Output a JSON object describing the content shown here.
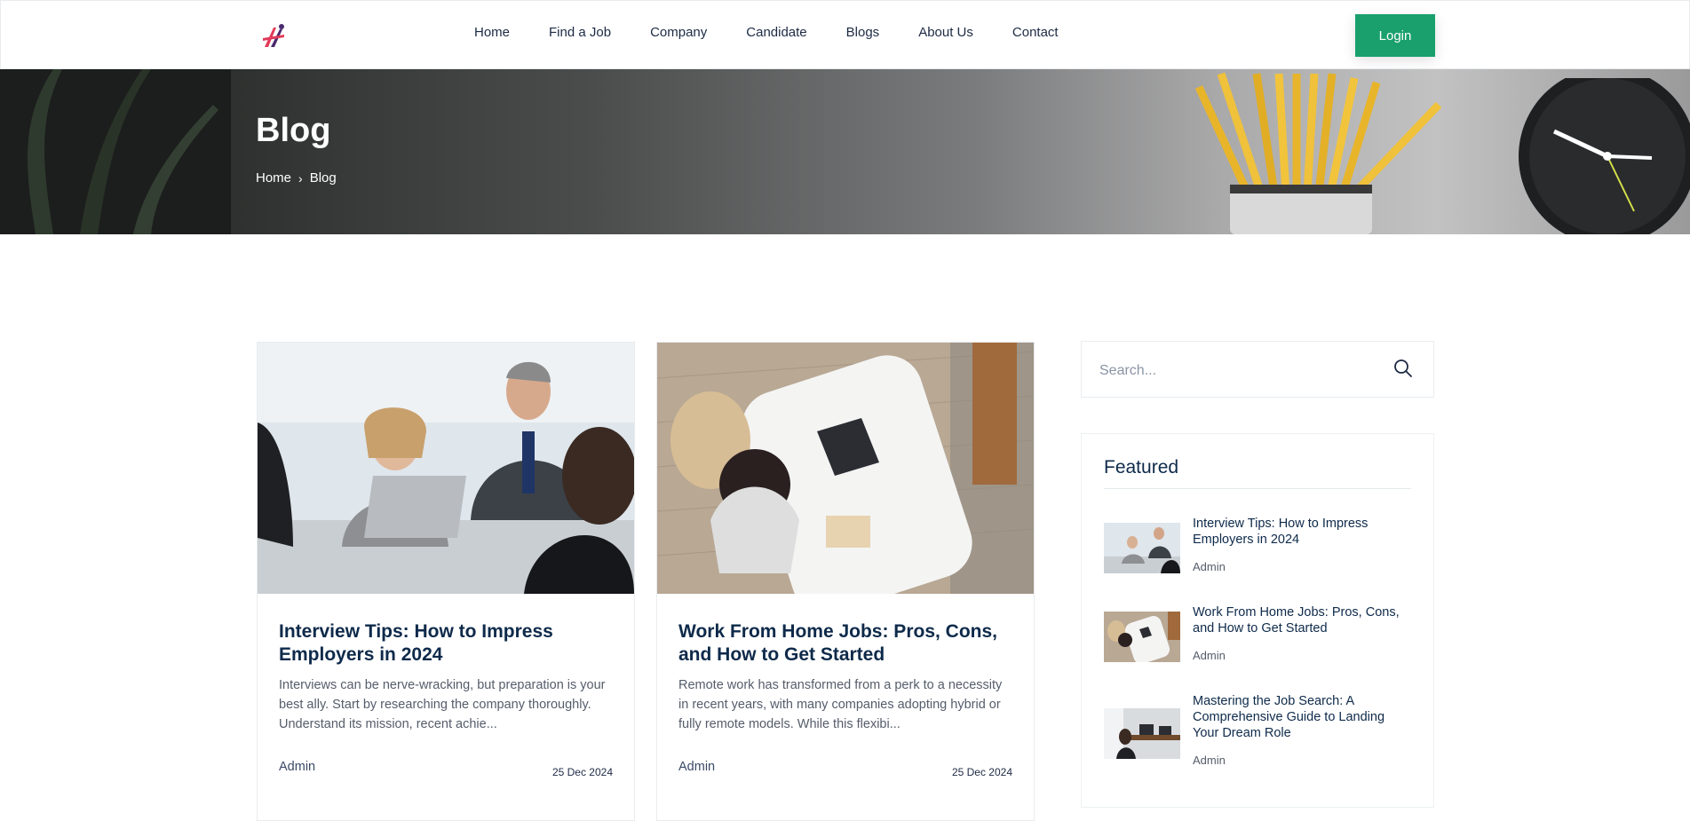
{
  "header": {
    "logo_icon": "brand-logo-icon",
    "nav": [
      "Home",
      "Find a Job",
      "Company",
      "Candidate",
      "Blogs",
      "About Us",
      "Contact"
    ],
    "login_label": "Login",
    "accent_color": "#1aa06d"
  },
  "hero": {
    "title": "Blog",
    "breadcrumb": {
      "home": "Home",
      "separator_icon": "chevron-right-icon",
      "current": "Blog"
    }
  },
  "posts": [
    {
      "title": "Interview Tips: How to Impress Employers in 2024",
      "excerpt": "Interviews can be nerve-wracking, but preparation is your best ally. Start by researching the company thoroughly. Understand its mission, recent achie...",
      "author": "Admin",
      "date": "25 Dec 2024"
    },
    {
      "title": "Work From Home Jobs: Pros, Cons, and How to Get Started",
      "excerpt": "Remote work has transformed from a perk to a necessity in recent years, with many companies adopting hybrid or fully remote models. While this flexibi...",
      "author": "Admin",
      "date": "25 Dec 2024"
    }
  ],
  "sidebar": {
    "search_placeholder": "Search...",
    "search_icon": "search-icon",
    "featured_title": "Featured",
    "featured": [
      {
        "title": "Interview Tips: How to Impress Employers in 2024",
        "author": "Admin"
      },
      {
        "title": "Work From Home Jobs: Pros, Cons, and How to Get Started",
        "author": "Admin"
      },
      {
        "title": "Mastering the Job Search: A Comprehensive Guide to Landing Your Dream Role",
        "author": "Admin"
      }
    ]
  }
}
